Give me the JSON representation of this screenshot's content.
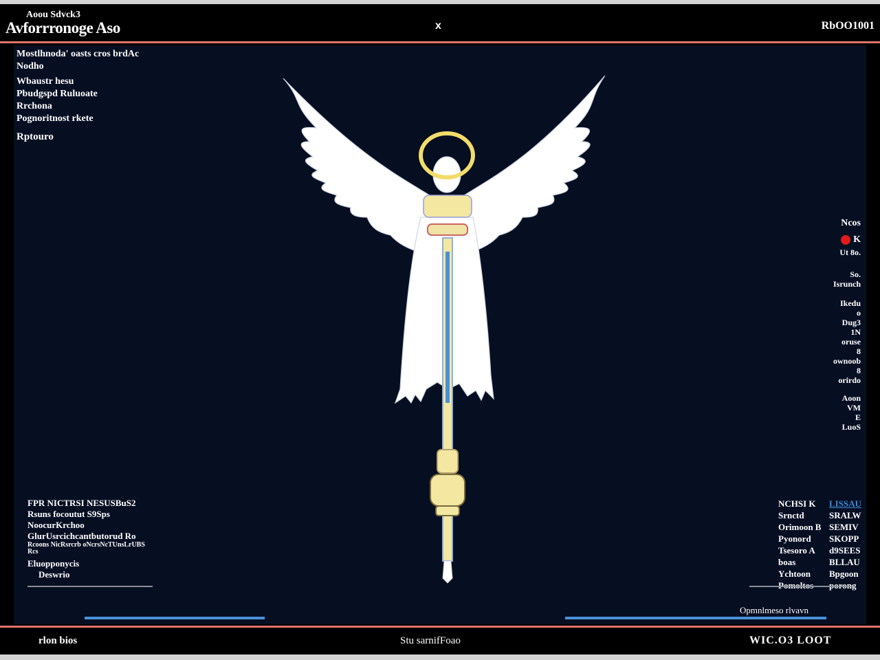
{
  "header": {
    "subtitle": "Aoou Sdvck3",
    "title": "Avforrronoge Aso",
    "close_label": "x",
    "right_label": "RbOO1001"
  },
  "info_panel": {
    "lines": [
      "Mostlhnoda' oasts cros brdAc",
      "Nodho",
      "Wbaustr hesu",
      "Pbudgspd Ruluoate",
      "Rrchona",
      "Pognoritnost rkete"
    ],
    "status": "Rptouro"
  },
  "right_panel": {
    "top_label": "Ncos",
    "rec_label": "K",
    "lines": [
      "Ut 8o.",
      "So.",
      "Isrunch",
      "Ikedu",
      "o",
      "Dug3",
      "1N",
      "oruse",
      "8",
      "ownoob",
      "8",
      "orirdo",
      "Aoon",
      "VM",
      "E",
      "LuoS"
    ]
  },
  "bottom_left_panel": {
    "lines": [
      "FPR NICTRSI NESUSBuS2",
      "Rsuns focoutut S9Sps",
      "NoocurKrchoo",
      "GlurUsrcichcantbutorud Ro"
    ],
    "small_lines": [
      "Rcoons NicRsrcrb oNcrsNcTUnsLrUBS",
      "Rcs"
    ],
    "lines_after": [
      "Eluopponycis",
      "Deswrio"
    ]
  },
  "bottom_right_panel": {
    "rows": [
      {
        "key": "NCHSI K",
        "value": "LISSAU",
        "accent": true
      },
      {
        "key": "Srnctd",
        "value": "SRALW",
        "accent": false
      },
      {
        "key": "Orimoon B",
        "value": "SEMIV",
        "accent": false
      },
      {
        "key": "Pyonord",
        "value": "SKOPP",
        "accent": false
      },
      {
        "key": "Tsesoro A",
        "value": "d9SEES",
        "accent": false
      },
      {
        "key": "boas",
        "value": "BLLAU",
        "accent": false
      },
      {
        "key": "Ychtoon",
        "value": "Bpgoon",
        "accent": false
      },
      {
        "key": "Pomoltos",
        "value": "porong",
        "accent": false
      }
    ],
    "caption": "Opmnlmeso rlvavn"
  },
  "footer": {
    "left_label": "rlon bios",
    "center_label": "Stu sarnifFoao",
    "right_label": "WIC.O3 LOOT"
  },
  "colors": {
    "accent_red": "#e0746b",
    "accent_blue": "#4a90d9",
    "rec_red": "#e01b1b",
    "canvas_bg": "#060e22"
  }
}
